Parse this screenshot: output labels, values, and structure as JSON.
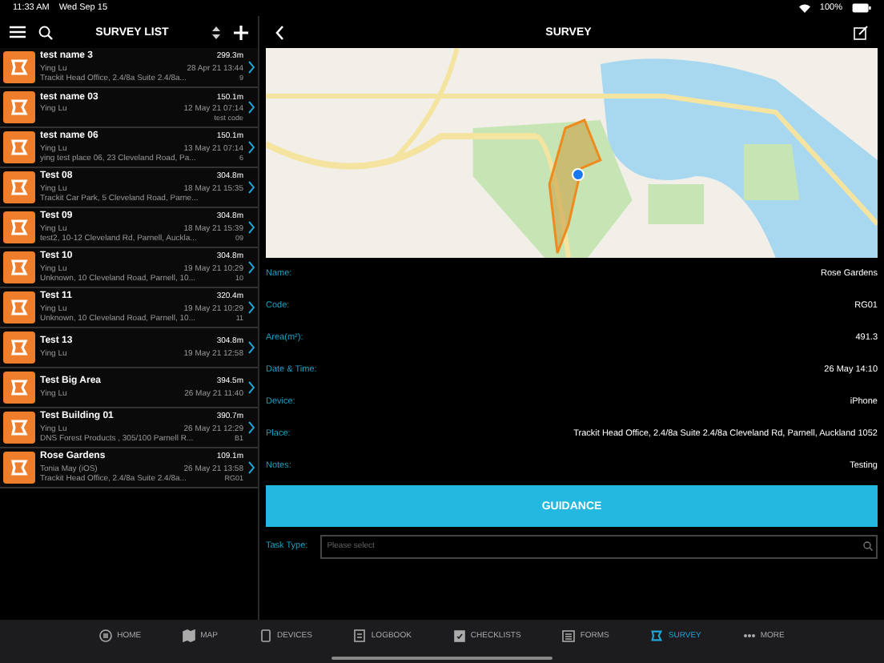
{
  "status_bar": {
    "time": "11:33 AM",
    "date": "Wed Sep 15",
    "battery": "100%"
  },
  "list_header": {
    "title": "SURVEY LIST"
  },
  "surveys": [
    {
      "title": "test name 3",
      "user": "Ying Lu",
      "distance": "299.3m",
      "date": "28 Apr 21 13:44",
      "place": "Trackit Head Office, 2.4/8a Suite 2.4/8a...",
      "code": "9"
    },
    {
      "title": "test name 03",
      "user": "Ying Lu",
      "distance": "150.1m",
      "date": "12 May 21 07:14",
      "code": "test code"
    },
    {
      "title": "test name 06",
      "user": "Ying Lu",
      "distance": "150.1m",
      "date": "13 May 21 07:14",
      "place": "ying test place 06, 23 Cleveland Road, Pa...",
      "code": "6"
    },
    {
      "title": "Test 08",
      "user": "Ying Lu",
      "distance": "304.8m",
      "date": "18 May 21 15:35",
      "place": "Trackit Car Park, 5 Cleveland Road, Parne..."
    },
    {
      "title": "Test 09",
      "user": "Ying Lu",
      "distance": "304.8m",
      "date": "18 May 21 15:39",
      "place": "test2, 10-12 Cleveland Rd, Parnell, Auckla...",
      "code": "09"
    },
    {
      "title": "Test 10",
      "user": "Ying Lu",
      "distance": "304.8m",
      "date": "19 May 21 10:29",
      "place": "Unknown, 10 Cleveland Road, Parnell, 10...",
      "code": "10"
    },
    {
      "title": "Test 11",
      "user": "Ying Lu",
      "distance": "320.4m",
      "date": "19 May 21 10:29",
      "place": "Unknown, 10 Cleveland Road, Parnell, 10...",
      "code": "11"
    },
    {
      "title": "Test 13",
      "user": "Ying Lu",
      "distance": "304.8m",
      "date": "19 May 21 12:58"
    },
    {
      "title": "Test Big Area",
      "user": "Ying Lu",
      "distance": "394.5m",
      "date": "26 May 21 11:40"
    },
    {
      "title": "Test Building 01",
      "user": "Ying Lu",
      "distance": "390.7m",
      "date": "26 May 21 12:29",
      "place": "DNS Forest Products , 305/100 Parnell R...",
      "code": "B1"
    },
    {
      "title": "Rose Gardens",
      "user": "Tonia May (iOS)",
      "distance": "109.1m",
      "date": "26 May 21 13:58",
      "place": "Trackit Head Office, 2.4/8a Suite 2.4/8a...",
      "code": "RG01"
    }
  ],
  "detail_header": {
    "title": "SURVEY"
  },
  "details": [
    {
      "label": "Name:",
      "value": "Rose Gardens"
    },
    {
      "label": "Code:",
      "value": "RG01"
    },
    {
      "label": "Area(m²):",
      "value": "491.3"
    },
    {
      "label": "Date & Time:",
      "value": "26 May 14:10"
    },
    {
      "label": "Device:",
      "value": "iPhone"
    },
    {
      "label": "Place:",
      "value": "Trackit Head Office, 2.4/8a Suite 2.4/8a Cleveland Rd, Parnell, Auckland 1052"
    },
    {
      "label": "Notes:",
      "value": "Testing"
    }
  ],
  "guidance_button": "GUIDANCE",
  "task_type": {
    "label": "Task Type:",
    "placeholder": "Please select"
  },
  "tabs": [
    {
      "kind": "home",
      "label": "HOME",
      "selected": false
    },
    {
      "kind": "map",
      "label": "MAP",
      "selected": false
    },
    {
      "kind": "devices",
      "label": "DEVICES",
      "selected": false
    },
    {
      "kind": "logbook",
      "label": "LOGBOOK",
      "selected": false
    },
    {
      "kind": "checklists",
      "label": "CHECKLISTS",
      "selected": false
    },
    {
      "kind": "forms",
      "label": "FORMS",
      "selected": false
    },
    {
      "kind": "survey",
      "label": "SURVEY",
      "selected": true
    },
    {
      "kind": "more",
      "label": "MORE",
      "selected": false
    }
  ]
}
